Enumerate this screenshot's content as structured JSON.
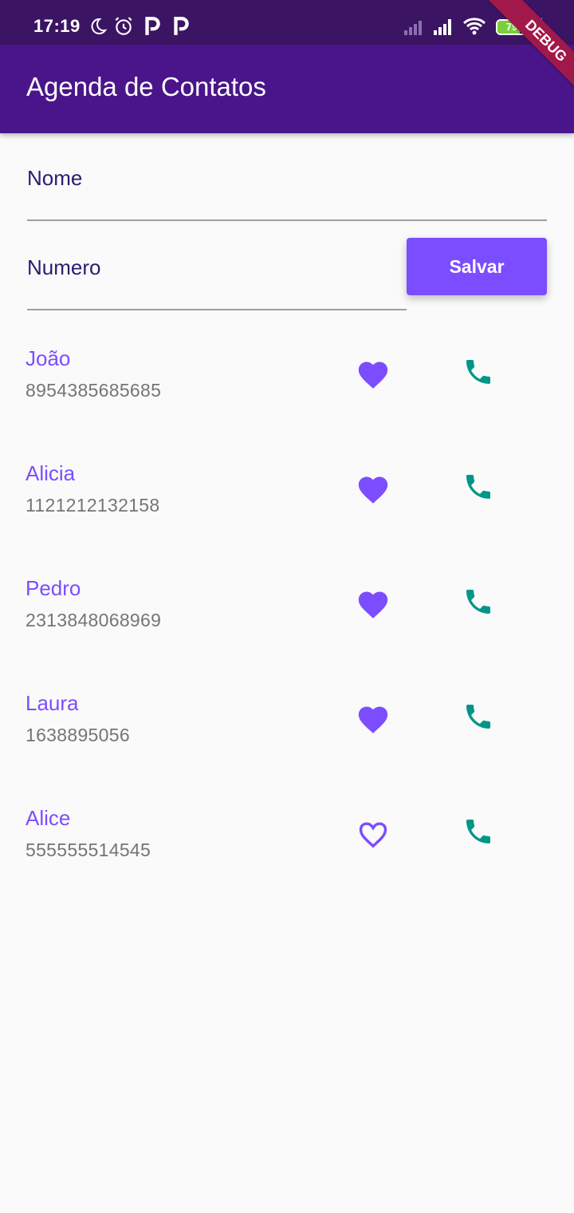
{
  "status_bar": {
    "time": "17:19",
    "battery_level": "79",
    "icons": [
      "moon-icon",
      "alarm-icon",
      "p-app-icon",
      "p-app-icon",
      "signal-off-icon",
      "signal-icon",
      "wifi-icon",
      "battery-icon",
      "charging-icon"
    ]
  },
  "debug_banner": "DEBUG",
  "app_bar": {
    "title": "Agenda de Contatos",
    "color": "#4a158a"
  },
  "form": {
    "name_label": "Nome",
    "number_label": "Numero",
    "save_label": "Salvar",
    "save_color": "#7c4dff"
  },
  "contacts": [
    {
      "name": "João",
      "number": "8954385685685",
      "favorite": true
    },
    {
      "name": "Alicia",
      "number": "1121212132158",
      "favorite": true
    },
    {
      "name": "Pedro",
      "number": "2313848068969",
      "favorite": true
    },
    {
      "name": "Laura",
      "number": "1638895056",
      "favorite": true
    },
    {
      "name": "Alice",
      "number": "555555514545",
      "favorite": false
    }
  ],
  "colors": {
    "accent": "#7c4dff",
    "call_icon": "#009688",
    "secondary_text": "#757575"
  }
}
